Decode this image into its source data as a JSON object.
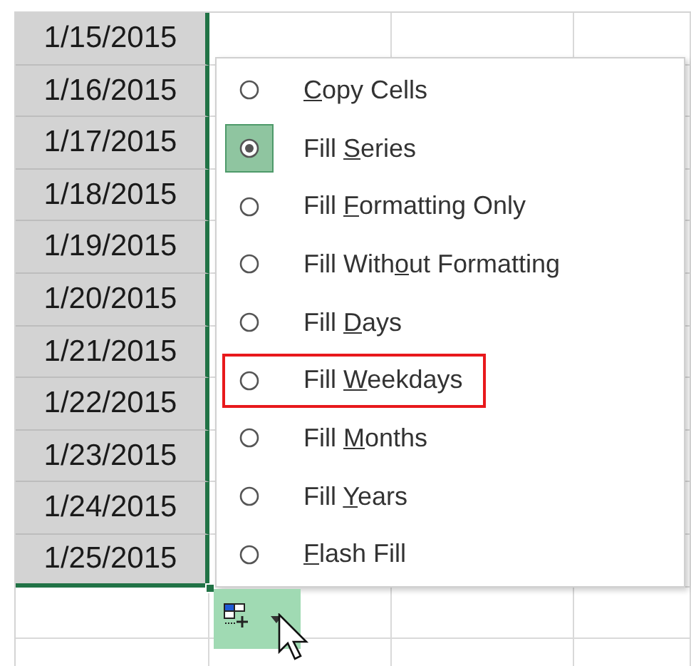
{
  "cells": [
    "1/15/2015",
    "1/16/2015",
    "1/17/2015",
    "1/18/2015",
    "1/19/2015",
    "1/20/2015",
    "1/21/2015",
    "1/22/2015",
    "1/23/2015",
    "1/24/2015",
    "1/25/2015"
  ],
  "menu": [
    {
      "key": "C",
      "after": "opy Cells",
      "selected": false,
      "highlighted": false
    },
    {
      "before": "Fill ",
      "key": "S",
      "after": "eries",
      "selected": true,
      "highlighted": false
    },
    {
      "before": "Fill ",
      "key": "F",
      "after": "ormatting Only",
      "selected": false,
      "highlighted": false
    },
    {
      "before": "Fill With",
      "key": "o",
      "after": "ut Formatting",
      "selected": false,
      "highlighted": false
    },
    {
      "before": "Fill ",
      "key": "D",
      "after": "ays",
      "selected": false,
      "highlighted": false
    },
    {
      "before": "Fill ",
      "key": "W",
      "after": "eekdays",
      "selected": false,
      "highlighted": true
    },
    {
      "before": "Fill ",
      "key": "M",
      "after": "onths",
      "selected": false,
      "highlighted": false
    },
    {
      "before": "Fill ",
      "key": "Y",
      "after": "ears",
      "selected": false,
      "highlighted": false
    },
    {
      "key": "F",
      "after": "lash Fill",
      "selected": false,
      "highlighted": false
    }
  ]
}
